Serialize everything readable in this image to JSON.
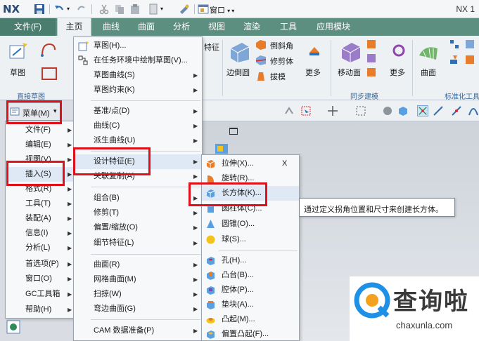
{
  "titlebar": {
    "logo": "NX",
    "window_menu": "窗口",
    "app_title": "NX 1"
  },
  "tabs": [
    {
      "label": "文件(F)"
    },
    {
      "label": "主页"
    },
    {
      "label": "曲线"
    },
    {
      "label": "曲面"
    },
    {
      "label": "分析"
    },
    {
      "label": "视图"
    },
    {
      "label": "渲染"
    },
    {
      "label": "工具"
    },
    {
      "label": "应用模块"
    }
  ],
  "ribbon": {
    "sketch_label": "草图",
    "direct_sketch_group": "直接草图",
    "feature_partial": "特征",
    "edge_blend": "边倒圆",
    "chamfer": "倒斜角",
    "trim_body": "修剪体",
    "draft": "拔模",
    "more1": "更多",
    "move_face": "移动面",
    "more2": "更多",
    "sync_group": "同步建模",
    "surface": "曲面",
    "std_surface_group": "标准化工具"
  },
  "menu_button": {
    "label": "菜单(M)"
  },
  "main_menu": [
    {
      "label": "文件(F)"
    },
    {
      "label": "编辑(E)"
    },
    {
      "label": "视图(V)"
    },
    {
      "label": "插入(S)"
    },
    {
      "label": "格式(R)"
    },
    {
      "label": "工具(T)"
    },
    {
      "label": "装配(A)"
    },
    {
      "label": "信息(I)"
    },
    {
      "label": "分析(L)"
    },
    {
      "label": "首选项(P)"
    },
    {
      "label": "窗口(O)"
    },
    {
      "label": "GC工具箱"
    },
    {
      "label": "帮助(H)"
    }
  ],
  "insert_menu": [
    {
      "label": "草图(H)..."
    },
    {
      "label": "在任务环境中绘制草图(V)..."
    },
    {
      "label": "草图曲线(S)"
    },
    {
      "label": "草图约束(K)"
    },
    {
      "label": "基准/点(D)"
    },
    {
      "label": "曲线(C)"
    },
    {
      "label": "派生曲线(U)"
    },
    {
      "label": "设计特征(E)"
    },
    {
      "label": "关联复制(A)"
    },
    {
      "label": "组合(B)"
    },
    {
      "label": "修剪(T)"
    },
    {
      "label": "偏置/缩放(O)"
    },
    {
      "label": "细节特征(L)"
    },
    {
      "label": "曲面(R)"
    },
    {
      "label": "网格曲面(M)"
    },
    {
      "label": "扫掠(W)"
    },
    {
      "label": "弯边曲面(G)"
    },
    {
      "label": "CAM 数据准备(P)"
    }
  ],
  "design_feature_menu": [
    {
      "label": "拉伸(X)..."
    },
    {
      "label": "旋转(R)..."
    },
    {
      "label": "长方体(K)..."
    },
    {
      "label": "圆柱体(C)..."
    },
    {
      "label": "圆锥(O)..."
    },
    {
      "label": "球(S)..."
    },
    {
      "label": "孔(H)..."
    },
    {
      "label": "凸台(B)..."
    },
    {
      "label": "腔体(P)..."
    },
    {
      "label": "垫块(A)..."
    },
    {
      "label": "凸起(M)..."
    },
    {
      "label": "偏置凸起(F)..."
    }
  ],
  "shortcut_x": "X",
  "tooltip": "通过定义拐角位置和尺寸来创建长方体。",
  "watermark": {
    "text": "查询啦",
    "url": "chaxunla.com"
  },
  "colors": {
    "tab_bar": "#5c8f7f",
    "highlight": "#e0101a",
    "accent_blue": "#1e90e6"
  }
}
